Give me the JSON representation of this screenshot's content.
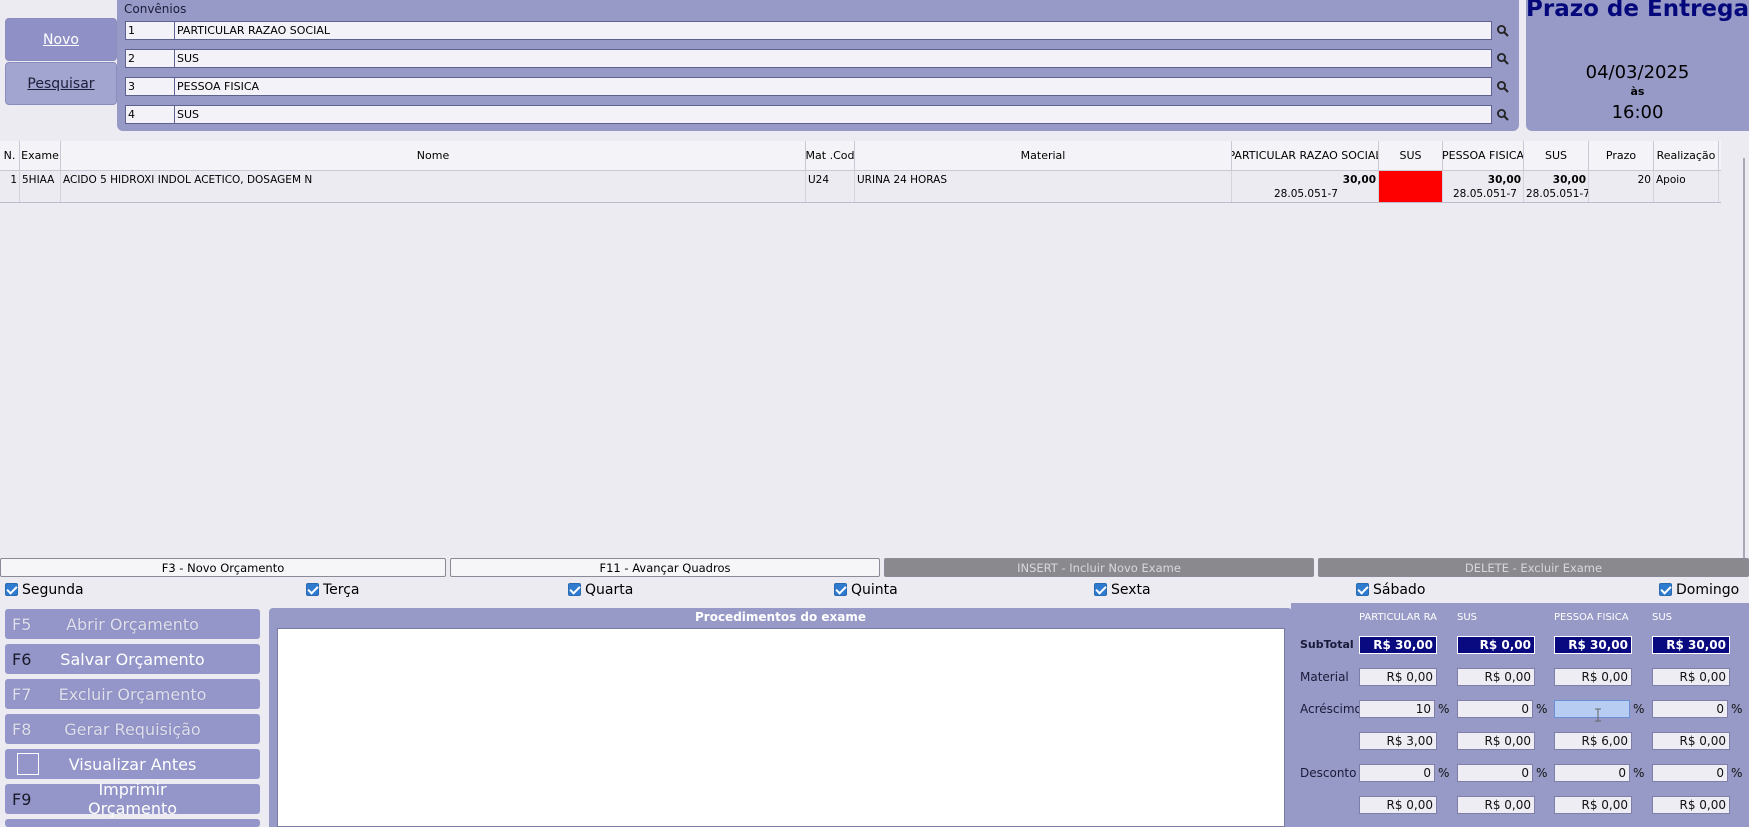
{
  "left_buttons": {
    "novo": "Novo",
    "pesquisar": "Pesquisar"
  },
  "convenios": {
    "title": "Convênios",
    "rows": [
      {
        "code": "1",
        "name": "PARTICULAR RAZAO SOCIAL"
      },
      {
        "code": "2",
        "name": "SUS"
      },
      {
        "code": "3",
        "name": "PESSOA FISICA"
      },
      {
        "code": "4",
        "name": "SUS"
      }
    ]
  },
  "prazo": {
    "title": "Prazo de Entrega",
    "date": "04/03/2025",
    "as": "às",
    "time": "16:00"
  },
  "table": {
    "headers": [
      "N.",
      "Exame",
      "Nome",
      "Mat .Cod",
      "Material",
      "PARTICULAR RAZAO SOCIAL",
      "SUS",
      "PESSOA FISICA",
      "SUS",
      "Prazo",
      "Realização"
    ],
    "rows": [
      {
        "n": "1",
        "exame": "5HIAA",
        "nome": "ACIDO 5 HIDROXI INDOL ACETICO, DOSAGEM N",
        "mat_cod": "U24",
        "material": "URINA 24 HORAS",
        "particular": "30,00",
        "particular_code": "28.05.051-7",
        "sus1": "",
        "pessoa": "30,00",
        "pessoa_code": "28.05.051-7",
        "sus2": "30,00",
        "sus2_code": "28.05.051-7",
        "prazo": "20",
        "realizacao": "Apoio"
      }
    ]
  },
  "function_bar": {
    "f3": "F3 -  Novo Orçamento",
    "f11": "F11 - Avançar Quadros",
    "insert": "INSERT - Incluir Novo Exame",
    "delete": "DELETE - Excluir Exame"
  },
  "days": [
    "Segunda",
    "Terça",
    "Quarta",
    "Quinta",
    "Sexta",
    "Sábado",
    "Domingo"
  ],
  "actions": [
    {
      "key": "F5",
      "label": "Abrir Orçamento",
      "enabled": false
    },
    {
      "key": "F6",
      "label": "Salvar Orçamento",
      "enabled": true
    },
    {
      "key": "F7",
      "label": "Excluir Orçamento",
      "enabled": false
    },
    {
      "key": "F8",
      "label": "Gerar Requisição",
      "enabled": false
    },
    {
      "key": "",
      "label": "Visualizar Antes",
      "enabled": true
    },
    {
      "key": "F9",
      "label": "Imprimir Orçamento",
      "enabled": true
    }
  ],
  "procedimentos": {
    "title": "Procedimentos do exame"
  },
  "totals": {
    "columns": [
      "PARTICULAR RAZAO SOCIAL",
      "SUS",
      "PESSOA FISICA",
      "SUS"
    ],
    "labels": {
      "subtotal": "SubTotal",
      "material": "Material",
      "acrescimo": "Acréscimo",
      "desconto": "Desconto"
    },
    "percent_sign": "%",
    "subtotal": [
      "R$ 30,00",
      "R$ 0,00",
      "R$ 30,00",
      "R$ 30,00"
    ],
    "material": [
      "R$ 0,00",
      "R$ 0,00",
      "R$ 0,00",
      "R$ 0,00"
    ],
    "acrescimo_pct": [
      "10",
      "0",
      "",
      "0"
    ],
    "acrescimo_val": [
      "R$ 3,00",
      "R$ 0,00",
      "R$ 6,00",
      "R$ 0,00"
    ],
    "desconto_pct": [
      "0",
      "0",
      "0",
      "0"
    ],
    "desconto_val": [
      "R$ 0,00",
      "R$ 0,00",
      "R$ 0,00",
      "R$ 0,00"
    ]
  },
  "colors": {
    "panel": "#979ac6",
    "navy": "#0a0a80",
    "empty_price": "#ff0000",
    "title": "#05087b"
  }
}
